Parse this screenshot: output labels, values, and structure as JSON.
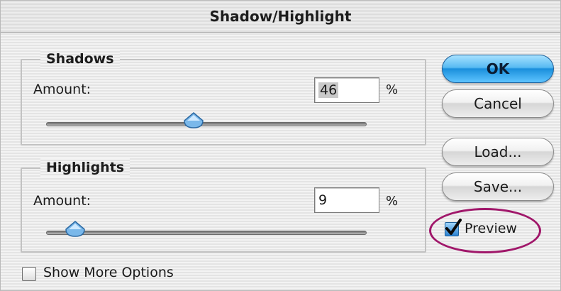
{
  "dialog": {
    "title": "Shadow/Highlight"
  },
  "shadows": {
    "legend": "Shadows",
    "amount_label": "Amount:",
    "amount_value": "46",
    "unit": "%",
    "slider_fraction": 0.46
  },
  "highlights": {
    "legend": "Highlights",
    "amount_label": "Amount:",
    "amount_value": "9",
    "unit": "%",
    "slider_fraction": 0.09
  },
  "buttons": {
    "ok": "OK",
    "cancel": "Cancel",
    "load": "Load...",
    "save": "Save..."
  },
  "preview": {
    "label": "Preview",
    "checked": true
  },
  "show_more_options": {
    "label": "Show More Options",
    "checked": false
  },
  "colors": {
    "ok_button": "#1a8fdc",
    "highlight_oval": "#a0176a",
    "slider_thumb": "#7ab8ea"
  },
  "icons": {
    "slider_thumb": "slider-thumb-icon",
    "checkmark": "checkmark-icon"
  }
}
